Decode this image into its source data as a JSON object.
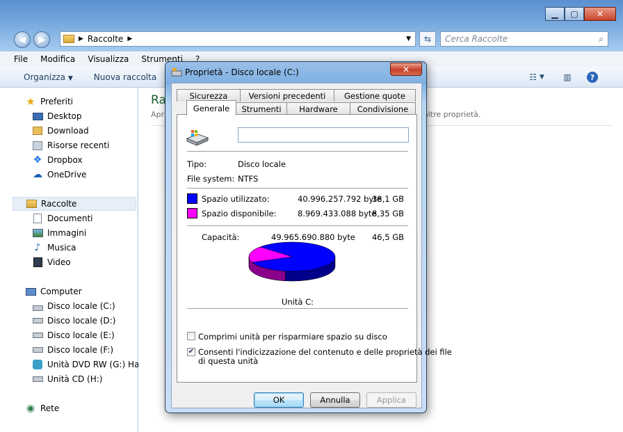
{
  "explorer": {
    "address": {
      "crumbs": [
        "Raccolte"
      ]
    },
    "search_placeholder": "Cerca Raccolte",
    "menu": [
      "File",
      "Modifica",
      "Visualizza",
      "Strumenti",
      "?"
    ],
    "toolbar": {
      "organize": "Organizza",
      "new_library": "Nuova raccolta"
    },
    "sidebar": {
      "favorites": {
        "label": "Preferiti",
        "items": [
          "Desktop",
          "Download",
          "Risorse recenti",
          "Dropbox",
          "OneDrive"
        ]
      },
      "libraries": {
        "label": "Raccolte",
        "items": [
          "Documenti",
          "Immagini",
          "Musica",
          "Video"
        ]
      },
      "computer": {
        "label": "Computer",
        "items": [
          "Disco locale (C:)",
          "Disco locale (D:)",
          "Disco locale (E:)",
          "Disco locale (F:)",
          "Unità DVD RW (G:) Happ",
          "Unità CD (H:)"
        ]
      },
      "network": {
        "label": "Rete"
      }
    },
    "content": {
      "title": "Ra",
      "subtitle": "Apri",
      "subtitle_tail": "altre proprietà."
    }
  },
  "dialog": {
    "title": "Proprietà - Disco locale (C:)",
    "tabs_back": [
      "Sicurezza",
      "Versioni precedenti",
      "Gestione quote"
    ],
    "tabs_front": [
      "Generale",
      "Strumenti",
      "Hardware",
      "Condivisione"
    ],
    "name_value": "",
    "type_label": "Tipo:",
    "type_value": "Disco locale",
    "fs_label": "File system:",
    "fs_value": "NTFS",
    "used": {
      "label": "Spazio utilizzato:",
      "bytes": "40.996.257.792 byte",
      "size": "38,1 GB",
      "color": "#0000ff"
    },
    "free": {
      "label": "Spazio disponibile:",
      "bytes": "8.969.433.088 byte",
      "size": "8,35 GB",
      "color": "#ff00ff"
    },
    "capacity": {
      "label": "Capacità:",
      "bytes": "49.965.690.880 byte",
      "size": "46,5 GB"
    },
    "used_fraction": 0.8205,
    "drive_label": "Unità C:",
    "compress": {
      "label": "Comprimi unità per risparmiare spazio su disco",
      "checked": false
    },
    "index": {
      "label_1": "Consenti l'indicizzazione del contenuto e delle proprietà dei file",
      "label_2": "di questa unità",
      "checked": true
    },
    "buttons": {
      "ok": "OK",
      "cancel": "Annulla",
      "apply": "Applica"
    }
  }
}
